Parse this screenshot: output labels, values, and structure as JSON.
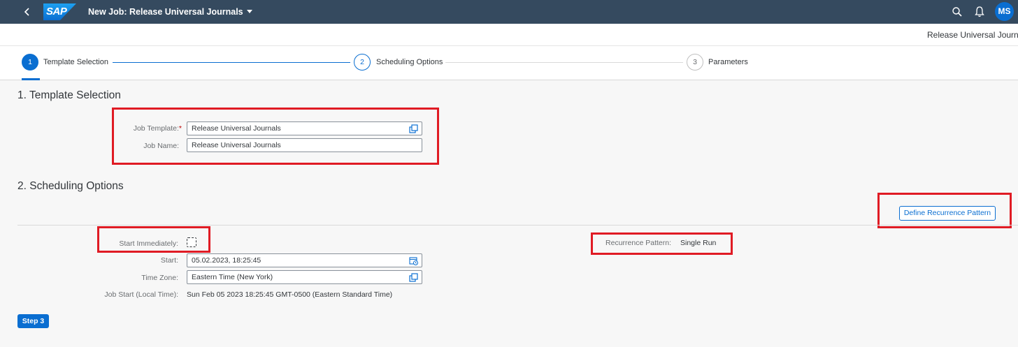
{
  "shell": {
    "logo_text": "SAP",
    "app_title": "New Job: Release Universal Journals",
    "avatar_initials": "MS",
    "icons": [
      "back-icon",
      "search-icon",
      "bell-icon"
    ],
    "colors": {
      "shell_bg": "#354a5f",
      "accent": "#0a6ed1",
      "highlight": "#e01b24"
    }
  },
  "header": {
    "object_title": "Release Universal Journals"
  },
  "wizard": {
    "steps": [
      {
        "number": "1",
        "label": "Template Selection",
        "state": "active"
      },
      {
        "number": "2",
        "label": "Scheduling Options",
        "state": "next"
      },
      {
        "number": "3",
        "label": "Parameters",
        "state": "future"
      }
    ]
  },
  "template_section": {
    "title": "1. Template Selection",
    "job_template_label": "Job Template:",
    "required_marker": "*",
    "job_template_value": "Release Universal Journals",
    "job_name_label": "Job Name:",
    "job_name_value": "Release Universal Journals"
  },
  "scheduling_section": {
    "title": "2. Scheduling Options",
    "define_recurrence_button": "Define Recurrence Pattern",
    "start_immediately_label": "Start Immediately:",
    "start_immediately_checked": false,
    "start_label": "Start:",
    "start_value": "05.02.2023, 18:25:45",
    "time_zone_label": "Time Zone:",
    "time_zone_value": "Eastern Time (New York)",
    "job_start_local_label": "Job Start (Local Time):",
    "job_start_local_value": "Sun Feb 05 2023 18:25:45 GMT-0500 (Eastern Standard Time)",
    "recurrence_label": "Recurrence Pattern:",
    "recurrence_value": "Single Run"
  },
  "footer": {
    "step3_button": "Step 3"
  }
}
